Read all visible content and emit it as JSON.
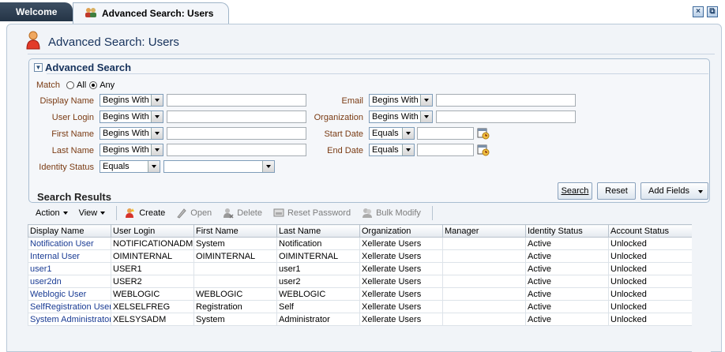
{
  "tabs": {
    "welcome": "Welcome",
    "active": "Advanced Search: Users"
  },
  "page": {
    "title": "Advanced Search: Users"
  },
  "search": {
    "section_title": "Advanced Search",
    "match_label": "Match",
    "match_all": "All",
    "match_any": "Any",
    "match_selected": "Any",
    "fields": {
      "display_name": {
        "label": "Display Name",
        "operator": "Begins With",
        "value": ""
      },
      "user_login": {
        "label": "User Login",
        "operator": "Begins With",
        "value": ""
      },
      "first_name": {
        "label": "First Name",
        "operator": "Begins With",
        "value": ""
      },
      "last_name": {
        "label": "Last Name",
        "operator": "Begins With",
        "value": ""
      },
      "identity_status": {
        "label": "Identity Status",
        "operator": "Equals",
        "value": ""
      },
      "email": {
        "label": "Email",
        "operator": "Begins With",
        "value": ""
      },
      "organization": {
        "label": "Organization",
        "operator": "Begins With",
        "value": ""
      },
      "start_date": {
        "label": "Start Date",
        "operator": "Equals",
        "value": ""
      },
      "end_date": {
        "label": "End Date",
        "operator": "Equals",
        "value": ""
      }
    },
    "buttons": {
      "search": "Search",
      "reset": "Reset",
      "add_fields": "Add Fields"
    }
  },
  "results": {
    "title": "Search Results",
    "toolbar": {
      "action": "Action",
      "view": "View",
      "create": "Create",
      "open": "Open",
      "delete": "Delete",
      "reset_password": "Reset Password",
      "bulk_modify": "Bulk Modify"
    },
    "columns": [
      "Display Name",
      "User Login",
      "First Name",
      "Last Name",
      "Organization",
      "Manager",
      "Identity Status",
      "Account Status"
    ],
    "rows": [
      [
        "Notification User",
        "NOTIFICATIONADMIN",
        "System",
        "Notification",
        "Xellerate Users",
        "",
        "Active",
        "Unlocked"
      ],
      [
        "Internal User",
        "OIMINTERNAL",
        "OIMINTERNAL",
        "OIMINTERNAL",
        "Xellerate Users",
        "",
        "Active",
        "Unlocked"
      ],
      [
        "user1",
        "USER1",
        "",
        "user1",
        "Xellerate Users",
        "",
        "Active",
        "Unlocked"
      ],
      [
        "user2dn",
        "USER2",
        "",
        "user2",
        "Xellerate Users",
        "",
        "Active",
        "Unlocked"
      ],
      [
        "Weblogic User",
        "WEBLOGIC",
        "WEBLOGIC",
        "WEBLOGIC",
        "Xellerate Users",
        "",
        "Active",
        "Unlocked"
      ],
      [
        "SelfRegistration User",
        "XELSELFREG",
        "Registration",
        "Self",
        "Xellerate Users",
        "",
        "Active",
        "Unlocked"
      ],
      [
        "System Administrator",
        "XELSYSADM",
        "System",
        "Administrator",
        "Xellerate Users",
        "",
        "Active",
        "Unlocked"
      ]
    ]
  },
  "icons": {
    "user": "user-icon",
    "calendar": "calendar-icon",
    "create": "create-user-icon"
  },
  "colors": {
    "label": "#7a3b13",
    "title": "#16325c",
    "link": "#1a3c94",
    "tab_dark": "#243446"
  }
}
